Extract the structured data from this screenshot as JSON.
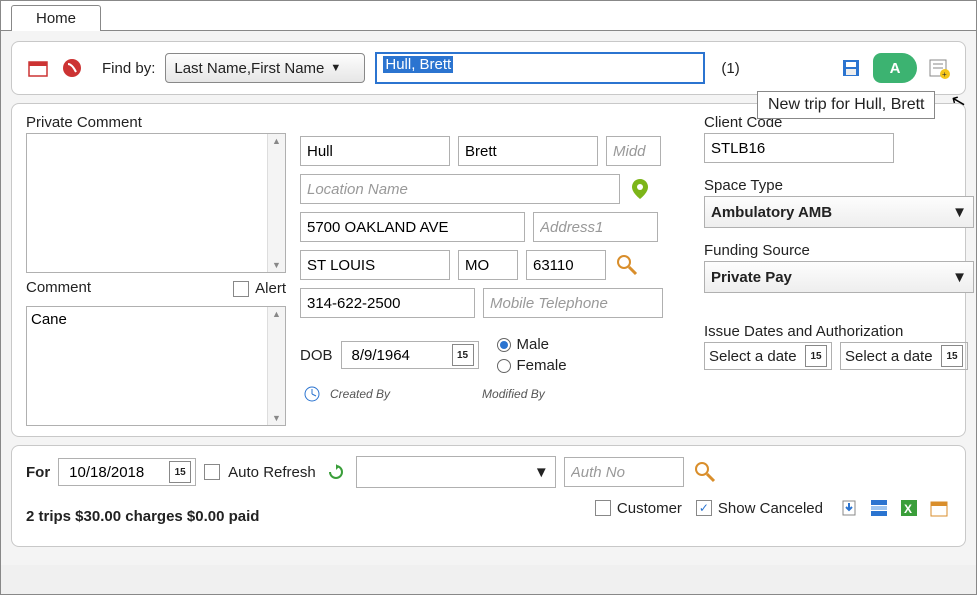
{
  "tab": {
    "home": "Home"
  },
  "toolbar": {
    "find_by_label": "Find by:",
    "find_by_value": "Last Name,First Name",
    "search_value": "Hull, Brett",
    "result_count": "(1)",
    "badge_letter": "A",
    "tooltip": "New trip for Hull, Brett"
  },
  "private_comment": {
    "label": "Private Comment",
    "value": ""
  },
  "comment": {
    "label": "Comment",
    "alert_label": "Alert",
    "value": "Cane"
  },
  "client": {
    "last_name": "Hull",
    "first_name": "Brett",
    "middle_placeholder": "Midd",
    "location_placeholder": "Location Name",
    "address": "5700 OAKLAND AVE",
    "address2_placeholder": "Address1",
    "city": "ST LOUIS",
    "state": "MO",
    "zip": "63110",
    "phone": "314-622-2500",
    "mobile_placeholder": "Mobile Telephone",
    "dob_label": "DOB",
    "dob": "8/9/1964",
    "gender_male": "Male",
    "gender_female": "Female",
    "created_by": "Created By",
    "modified_by": "Modified By"
  },
  "right": {
    "client_code_label": "Client Code",
    "client_code": "STLB16",
    "space_type_label": "Space Type",
    "space_type": "Ambulatory AMB",
    "funding_label": "Funding Source",
    "funding": "Private Pay",
    "issue_label": "Issue Dates and Authorization",
    "select_date": "Select a date"
  },
  "bottom": {
    "for_label": "For",
    "for_date": "10/18/2018",
    "auto_refresh": "Auto Refresh",
    "auth_placeholder": "Auth No",
    "customer": "Customer",
    "show_canceled": "Show Canceled",
    "summary": "2 trips $30.00 charges $0.00 paid"
  }
}
